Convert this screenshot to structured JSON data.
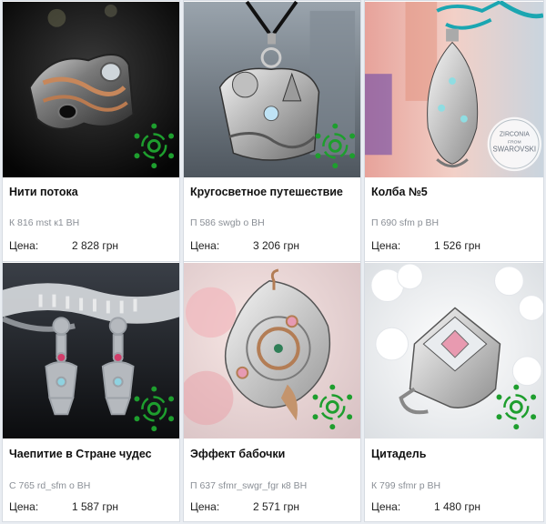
{
  "products": [
    {
      "title": "Нити потока",
      "sku": "К 816 mst к1 ВН",
      "price_label": "Цена:",
      "price": "2 828 грн"
    },
    {
      "title": "Кругосветное путешествие",
      "sku": "П 586 swgb о ВН",
      "price_label": "Цена:",
      "price": "3 206 грн"
    },
    {
      "title": "Колба №5",
      "sku": "П 690 sfm р ВН",
      "price_label": "Цена:",
      "price": "1 526 грн",
      "badge_top": "ZIRCONIA",
      "badge_mid": "FROM",
      "badge_bottom": "SWAROVSKI"
    },
    {
      "title": "Чаепитие в Стране чудес",
      "sku": "С 765 rd_sfm о ВН",
      "price_label": "Цена:",
      "price": "1 587 грн"
    },
    {
      "title": "Эффект бабочки",
      "sku": "П 637 sfmr_swgr_fgr к8 ВН",
      "price_label": "Цена:",
      "price": "2 571 грн"
    },
    {
      "title": "Цитадель",
      "sku": "К 799 sfmr р ВН",
      "price_label": "Цена:",
      "price": "1 480 грн"
    }
  ],
  "colors": {
    "accent_green": "#1e9e2e",
    "background": "#e9edf2",
    "card": "#ffffff",
    "sku_gray": "#8a8f96"
  },
  "icons": {
    "logo": "green-spiral-logo-icon"
  }
}
